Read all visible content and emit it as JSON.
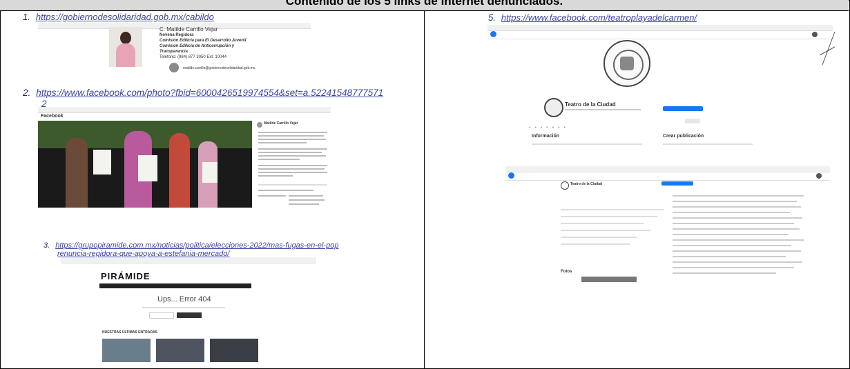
{
  "header": {
    "title": "Contenido de los 5 links de internet denunciados."
  },
  "links": [
    {
      "num": "1.",
      "url": "https://gobiernodesolidaridad.gob.mx/cabildo"
    },
    {
      "num": "2.",
      "url": "https://www.facebook.com/photo?fbid=6000426519974554&set=a.52241548777571",
      "url_cont": "2"
    },
    {
      "num": "3.",
      "url": "https://grupopiramide.com.mx/noticias/politica/elecciones-2022/mas-fugas-en-el-pop",
      "url_cont": "renuncia-regidora-que-apoya-a-estefania-mercado/"
    },
    {
      "num": "5.",
      "url": "https://www.facebook.com/teatroplayadelcarmen/"
    }
  ],
  "shot1": {
    "name": "C. Matilde Carrillo Vejar",
    "role": "Novena Regidora",
    "comm1": "Comisión Edilicia para El Desarrollo Juvenil",
    "comm2": "Comisión Edilicia de Anticorrupción y",
    "comm3": "Transparencia",
    "phone": "Teléfono: (984) 877 3050 Ext. 10044",
    "email": "matilde.carrillo@gobiernodesolidaridad.gob.mx"
  },
  "shot2": {
    "brand": "Facebook",
    "author": "Matilde Carrillo Vejar"
  },
  "shot3": {
    "logo": "PIRÁMIDE",
    "error": "Ups... Error 404",
    "section": "NUESTRAS ÚLTIMAS ENTRADAS"
  },
  "shot5": {
    "page_name": "Teatro de la Ciudad",
    "info": "Información",
    "create": "Crear publicación",
    "photos": "Fotos"
  }
}
